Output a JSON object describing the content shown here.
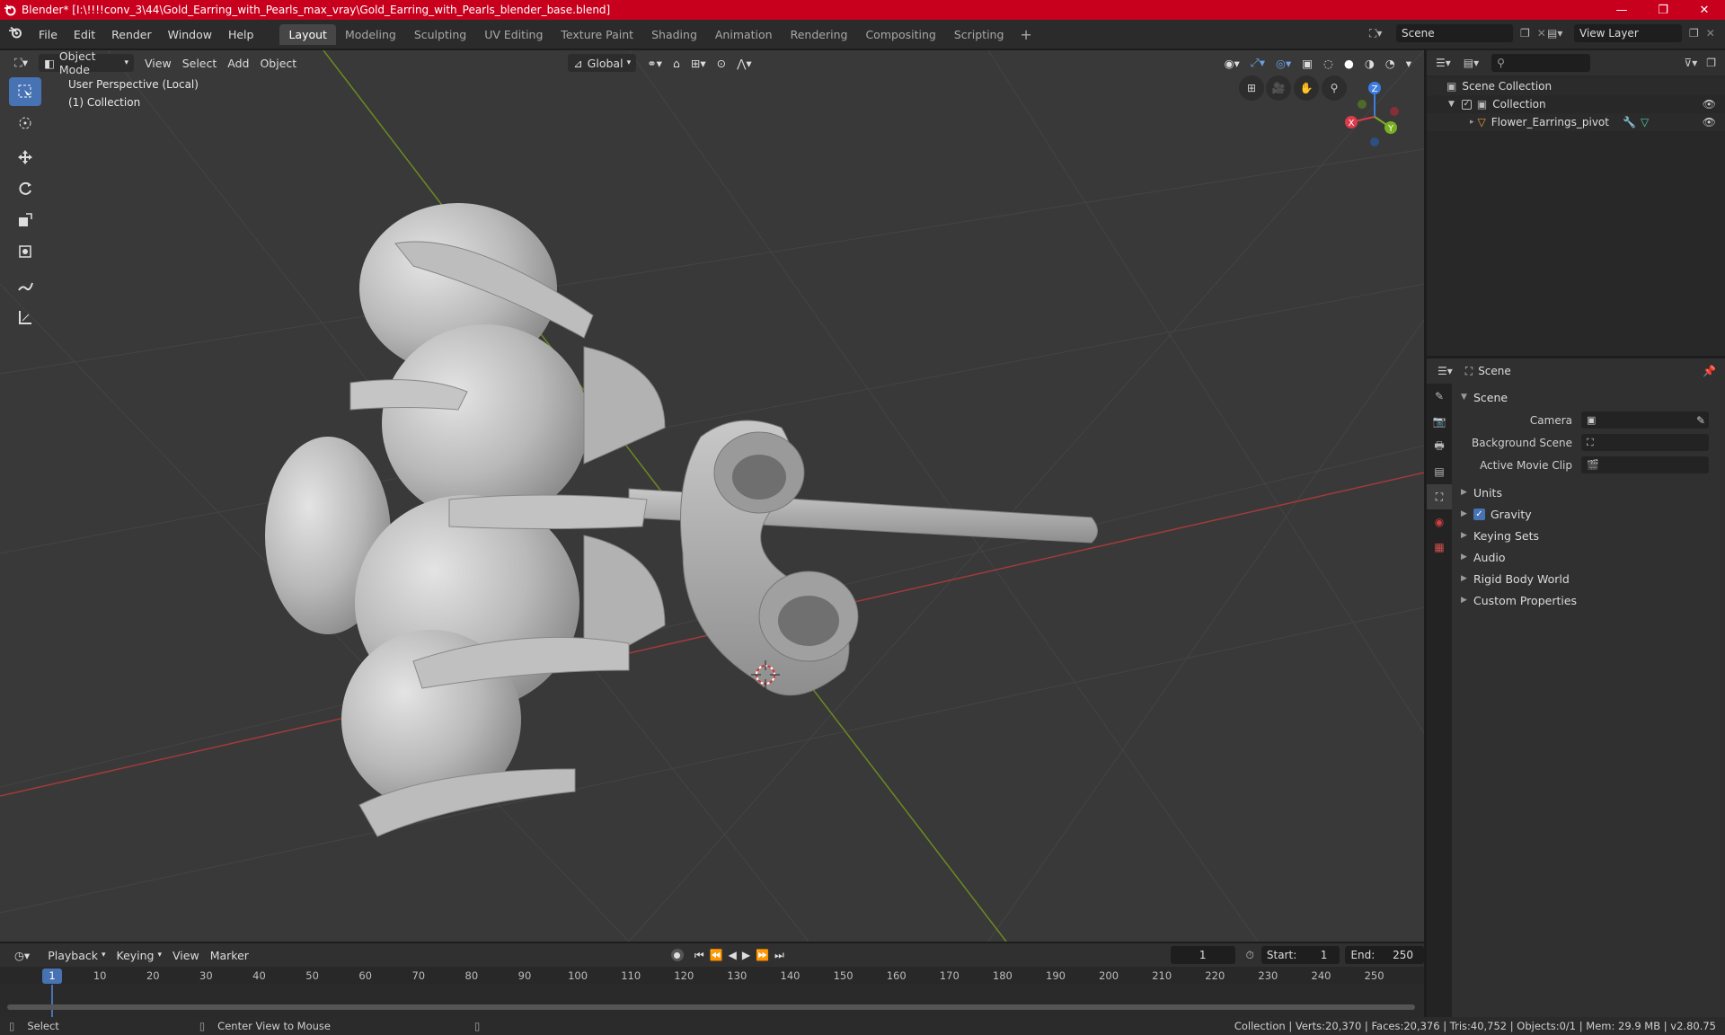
{
  "titlebar": {
    "title": "Blender* [I:\\!!!!conv_3\\44\\Gold_Earring_with_Pearls_max_vray\\Gold_Earring_with_Pearls_blender_base.blend]",
    "minimize": "—",
    "maximize": "❐",
    "close": "✕"
  },
  "menubar": {
    "items": [
      "File",
      "Edit",
      "Render",
      "Window",
      "Help"
    ],
    "workspaces": [
      "Layout",
      "Modeling",
      "Sculpting",
      "UV Editing",
      "Texture Paint",
      "Shading",
      "Animation",
      "Rendering",
      "Compositing",
      "Scripting"
    ],
    "active_workspace": "Layout",
    "add_workspace": "+",
    "scene": "Scene",
    "view_layer": "View Layer"
  },
  "viewport": {
    "mode": "Object Mode",
    "menus": [
      "View",
      "Select",
      "Add",
      "Object"
    ],
    "orientation": "Global",
    "perspective_label": "User Perspective (Local)",
    "collection_label": "(1) Collection",
    "gizmo": {
      "x": "X",
      "y": "Y",
      "z": "Z"
    }
  },
  "outliner": {
    "search_placeholder": "",
    "root": "Scene Collection",
    "collection": "Collection",
    "object": "Flower_Earrings_pivot"
  },
  "properties": {
    "context": "Scene",
    "panel": "Scene",
    "fields": [
      {
        "label": "Camera",
        "value": ""
      },
      {
        "label": "Background Scene",
        "value": ""
      },
      {
        "label": "Active Movie Clip",
        "value": ""
      }
    ],
    "subpanels": [
      "Units",
      "Gravity",
      "Keying Sets",
      "Audio",
      "Rigid Body World",
      "Custom Properties"
    ],
    "gravity_checked": true
  },
  "timeline": {
    "menus": [
      "Playback",
      "Keying",
      "View",
      "Marker"
    ],
    "current_frame": "1",
    "start_label": "Start:",
    "start": "1",
    "end_label": "End:",
    "end": "250",
    "ticks": [
      "10",
      "20",
      "30",
      "40",
      "50",
      "60",
      "70",
      "80",
      "90",
      "100",
      "110",
      "120",
      "130",
      "140",
      "150",
      "160",
      "170",
      "180",
      "190",
      "200",
      "210",
      "220",
      "230",
      "240",
      "250"
    ],
    "cursor_label": "1"
  },
  "statusbar": {
    "left": "Select",
    "middle": "Center View to Mouse",
    "right": "Collection | Verts:20,370 | Faces:20,376 | Tris:40,752 | Objects:0/1 | Mem: 29.9 MB | v2.80.75"
  }
}
